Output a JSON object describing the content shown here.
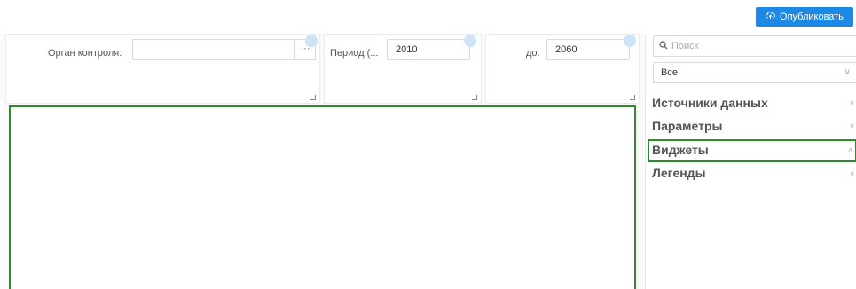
{
  "toolbar": {
    "publish_label": "Опубликовать"
  },
  "filters": {
    "organ_label": "Орган контроля:",
    "organ_value": "",
    "organ_button": "···",
    "period_label": "Период (...",
    "period_from": "2010",
    "to_label": "до:",
    "period_to": "2060"
  },
  "panel": {
    "search_placeholder": "Поиск",
    "select_value": "Все",
    "sections": [
      {
        "label": "Источники данных",
        "active": false
      },
      {
        "label": "Параметры",
        "active": false
      },
      {
        "label": "Виджеты",
        "active": true
      },
      {
        "label": "Легенды",
        "active": false
      }
    ]
  },
  "colors": {
    "accent": "#1e88e5",
    "selection": "#2e8b2e"
  }
}
